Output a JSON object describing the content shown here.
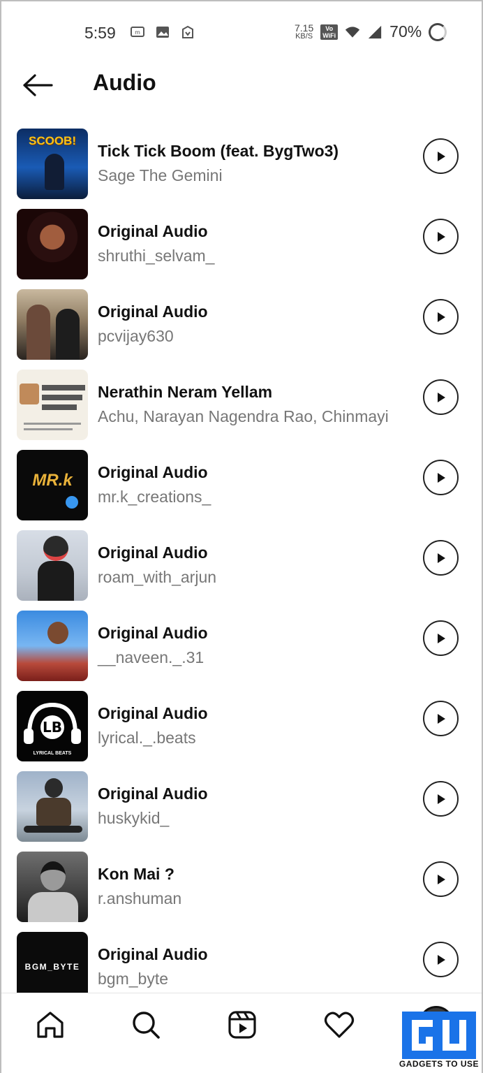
{
  "status_bar": {
    "time": "5:59",
    "speed_value": "7.15",
    "speed_unit": "KB/S",
    "vowifi_top": "Vo",
    "vowifi_bottom": "WiFi",
    "battery": "70%"
  },
  "header": {
    "title": "Audio"
  },
  "tracks": [
    {
      "title": "Tick Tick Boom (feat. BygTwo3)",
      "artist": "Sage The Gemini",
      "thumb_text": "SCOOB!"
    },
    {
      "title": "Original Audio",
      "artist": "shruthi_selvam_",
      "thumb_text": ""
    },
    {
      "title": "Original Audio",
      "artist": "pcvijay630",
      "thumb_text": ""
    },
    {
      "title": "Nerathin Neram Yellam",
      "artist": "Achu, Narayan Nagendra Rao, Chinmayi",
      "thumb_text": ""
    },
    {
      "title": "Original Audio",
      "artist": "mr.k_creations_",
      "thumb_text": "MR.k"
    },
    {
      "title": "Original Audio",
      "artist": "roam_with_arjun",
      "thumb_text": ""
    },
    {
      "title": "Original Audio",
      "artist": "__naveen._.31",
      "thumb_text": ""
    },
    {
      "title": "Original Audio",
      "artist": "lyrical._.beats",
      "thumb_text": "LYRICAL BEATS"
    },
    {
      "title": "Original Audio",
      "artist": "huskykid_",
      "thumb_text": ""
    },
    {
      "title": "Kon Mai ?",
      "artist": "r.anshuman",
      "thumb_text": ""
    },
    {
      "title": "Original Audio",
      "artist": "bgm_byte",
      "thumb_text": "BGM_BYTE"
    }
  ],
  "bottom_nav": {
    "items": [
      "home-icon",
      "search-icon",
      "reels-icon",
      "heart-icon",
      "profile-avatar"
    ]
  },
  "watermark": {
    "text": "GADGETS TO USE"
  },
  "colors": {
    "text_primary": "#111111",
    "text_secondary": "#777777",
    "watermark_blue": "#1a73e8"
  }
}
